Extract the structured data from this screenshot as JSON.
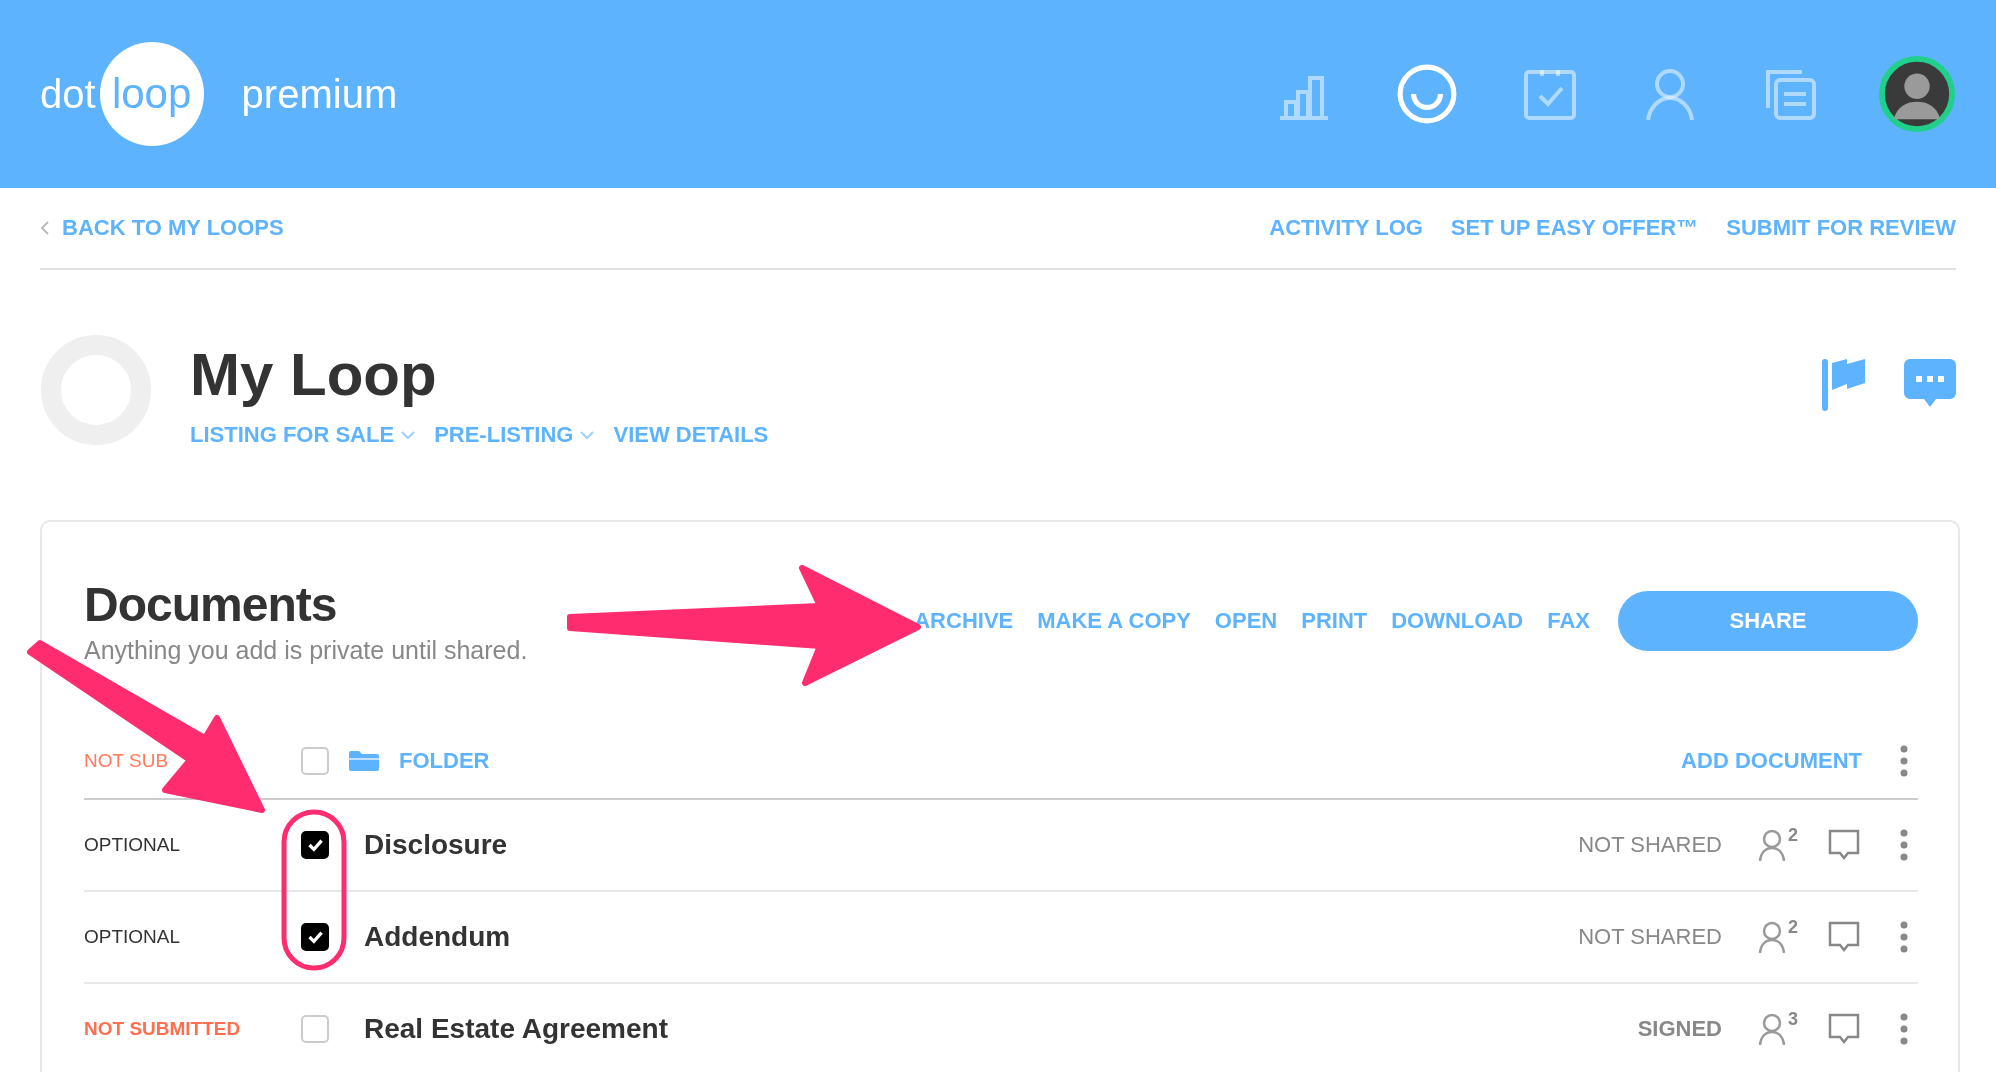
{
  "header": {
    "logo": {
      "dot": "dot",
      "loop": "loop"
    },
    "plan": "premium"
  },
  "breadcrumb": {
    "back": "BACK TO MY LOOPS",
    "links": [
      "ACTIVITY LOG",
      "SET UP EASY OFFER™",
      "SUBMIT FOR REVIEW"
    ]
  },
  "loop": {
    "title": "My Loop",
    "links": [
      {
        "label": "LISTING FOR SALE",
        "kind": "dropdown"
      },
      {
        "label": "PRE-LISTING",
        "kind": "dropdown"
      },
      {
        "label": "VIEW DETAILS",
        "kind": "link"
      }
    ]
  },
  "documents": {
    "title": "Documents",
    "subtitle": "Anything you add is private until shared.",
    "actions": [
      "ARCHIVE",
      "MAKE A COPY",
      "OPEN",
      "PRINT",
      "DOWNLOAD",
      "FAX"
    ],
    "share_button": "SHARE",
    "folder_row": {
      "status": "NOT SUB",
      "checked": false,
      "label": "FOLDER",
      "add_button": "ADD DOCUMENT"
    },
    "rows": [
      {
        "status": "OPTIONAL",
        "alert": false,
        "checked": true,
        "name": "Disclosure",
        "share_status": "NOT SHARED",
        "emphasized": false,
        "participants": "2"
      },
      {
        "status": "OPTIONAL",
        "alert": false,
        "checked": true,
        "name": "Addendum",
        "share_status": "NOT SHARED",
        "emphasized": false,
        "participants": "2"
      },
      {
        "status": "NOT SUBMITTED",
        "alert": true,
        "checked": false,
        "name": "Real Estate Agreement",
        "share_status": "SIGNED",
        "emphasized": true,
        "participants": "3"
      }
    ]
  }
}
